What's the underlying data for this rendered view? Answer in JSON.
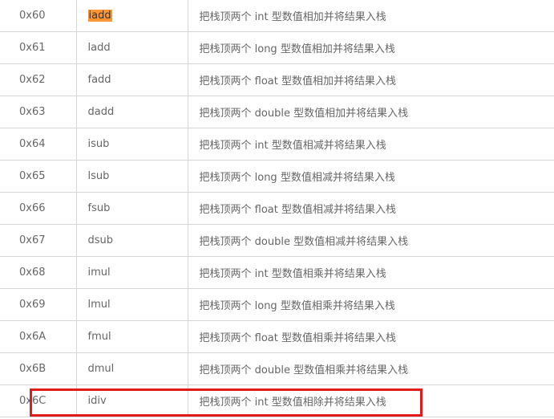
{
  "rows": [
    {
      "code": "0x60",
      "mnemonic": "iadd",
      "desc": "把栈顶两个 int 型数值相加并将结果入栈",
      "highlighted": true
    },
    {
      "code": "0x61",
      "mnemonic": "ladd",
      "desc": "把栈顶两个 long 型数值相加并将结果入栈"
    },
    {
      "code": "0x62",
      "mnemonic": "fadd",
      "desc": "把栈顶两个 float 型数值相加并将结果入栈"
    },
    {
      "code": "0x63",
      "mnemonic": "dadd",
      "desc": "把栈顶两个 double 型数值相加并将结果入栈"
    },
    {
      "code": "0x64",
      "mnemonic": "isub",
      "desc": "把栈顶两个 int 型数值相减并将结果入栈"
    },
    {
      "code": "0x65",
      "mnemonic": "lsub",
      "desc": "把栈顶两个 long 型数值相减并将结果入栈"
    },
    {
      "code": "0x66",
      "mnemonic": "fsub",
      "desc": "把栈顶两个 float 型数值相减并将结果入栈"
    },
    {
      "code": "0x67",
      "mnemonic": "dsub",
      "desc": "把栈顶两个 double 型数值相减并将结果入栈"
    },
    {
      "code": "0x68",
      "mnemonic": "imul",
      "desc": "把栈顶两个 int 型数值相乘并将结果入栈"
    },
    {
      "code": "0x69",
      "mnemonic": "lmul",
      "desc": "把栈顶两个 long 型数值相乘并将结果入栈"
    },
    {
      "code": "0x6A",
      "mnemonic": "fmul",
      "desc": "把栈顶两个 float 型数值相乘并将结果入栈"
    },
    {
      "code": "0x6B",
      "mnemonic": "dmul",
      "desc": "把栈顶两个 double 型数值相乘并将结果入栈"
    },
    {
      "code": "0x6C",
      "mnemonic": "idiv",
      "desc": "把栈顶两个 int 型数值相除并将结果入栈",
      "boxed": true
    }
  ],
  "colors": {
    "highlight": "#ff9632",
    "box": "#e11a1a",
    "border": "#d6d6d6",
    "text": "#666666"
  }
}
